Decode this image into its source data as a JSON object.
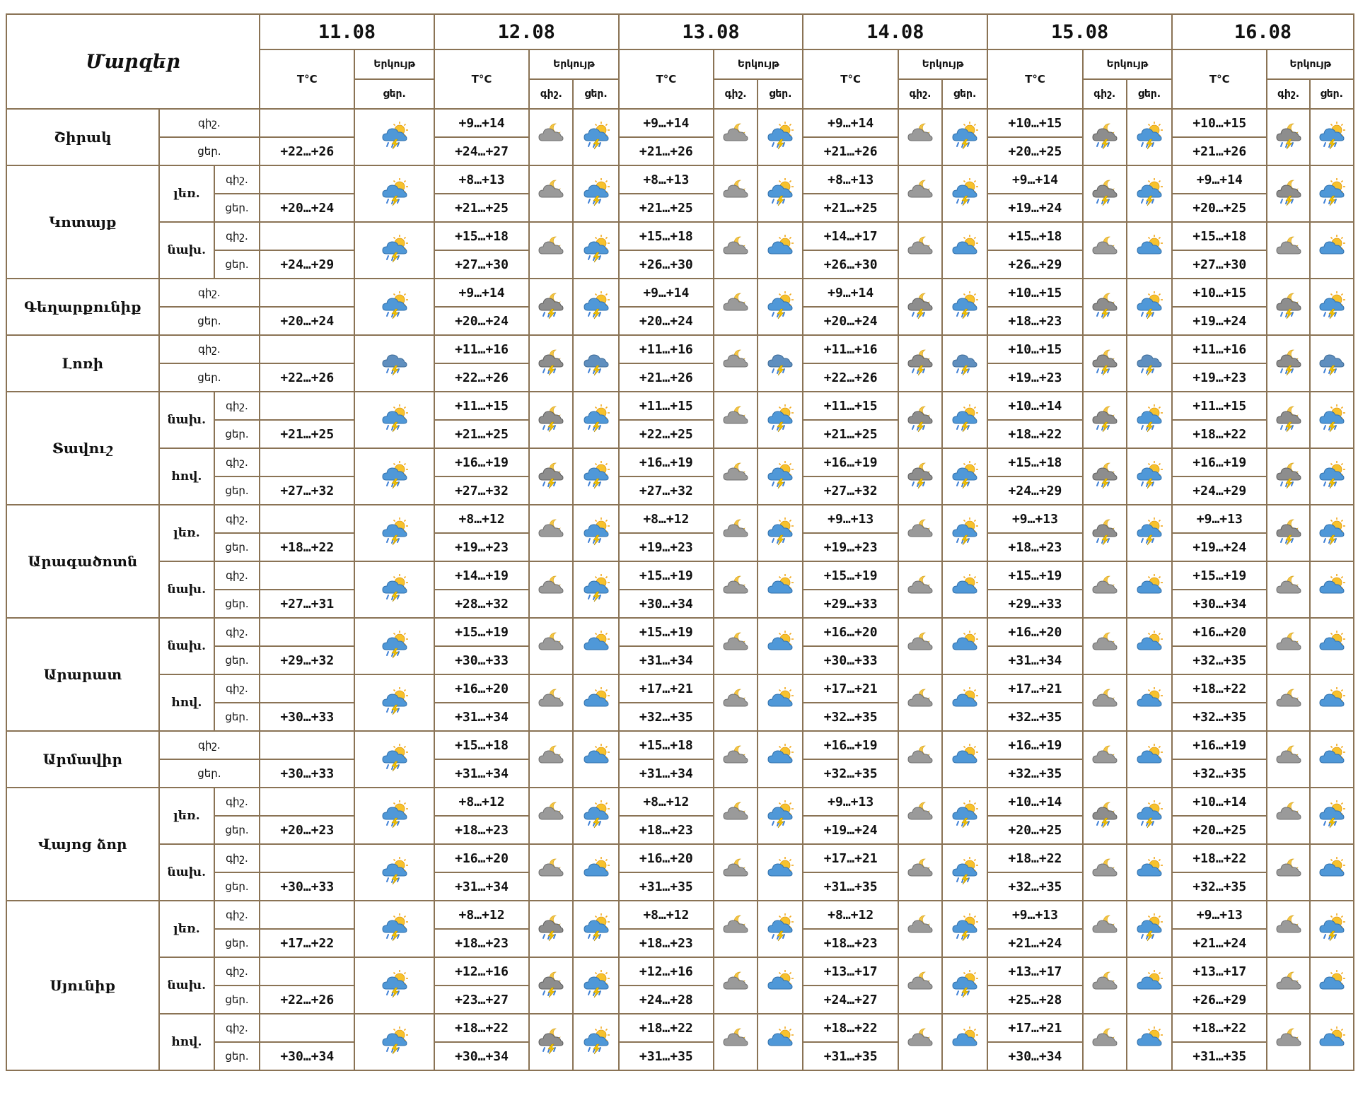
{
  "header": {
    "regions_label": "Մարզեր",
    "temp_label": "T°C",
    "sky_label": "Երկույթ",
    "night_label": "գիշ.",
    "day_label": "ցեր.",
    "dates": [
      "11.08",
      "12.08",
      "13.08",
      "14.08",
      "15.08",
      "16.08"
    ]
  },
  "icon_legend": {
    "storm-cloud": "dark cloud with rain and lightning",
    "cloud-moon": "grey cloud with moon",
    "cloud-sun-storm": "sun behind cloud with rain and lightning",
    "cloud-sun": "sun behind blue cloud",
    "storm-moon": "grey cloud with moon, rain and lightning"
  },
  "regions": [
    {
      "name": "Շիրակ",
      "zones": [
        {
          "zone": "",
          "night": [
            "",
            "+9…+14",
            "+9…+14",
            "+9…+14",
            "+10…+15",
            "+10…+15"
          ],
          "day": [
            "+22…+26",
            "+24…+27",
            "+21…+26",
            "+21…+26",
            "+20…+25",
            "+21…+26"
          ],
          "icons_night": [
            "cloud-moon",
            "cloud-moon",
            "cloud-moon",
            "storm-moon",
            "storm-moon"
          ],
          "icons_day": [
            "cloud-sun-storm",
            "cloud-sun-storm",
            "cloud-sun-storm",
            "cloud-sun-storm",
            "cloud-sun-storm",
            "cloud-sun-storm"
          ]
        }
      ]
    },
    {
      "name": "Կոտայք",
      "zones": [
        {
          "zone": "լեռ.",
          "night": [
            "",
            "+8…+13",
            "+8…+13",
            "+8…+13",
            "+9…+14",
            "+9…+14"
          ],
          "day": [
            "+20…+24",
            "+21…+25",
            "+21…+25",
            "+21…+25",
            "+19…+24",
            "+20…+25"
          ],
          "icons_night": [
            "cloud-moon",
            "cloud-moon",
            "cloud-moon",
            "storm-moon",
            "storm-moon"
          ],
          "icons_day": [
            "cloud-sun-storm",
            "cloud-sun-storm",
            "cloud-sun-storm",
            "cloud-sun-storm",
            "cloud-sun-storm",
            "cloud-sun-storm"
          ]
        },
        {
          "zone": "նախ.",
          "night": [
            "",
            "+15…+18",
            "+15…+18",
            "+14…+17",
            "+15…+18",
            "+15…+18"
          ],
          "day": [
            "+24…+29",
            "+27…+30",
            "+26…+30",
            "+26…+30",
            "+26…+29",
            "+27…+30"
          ],
          "icons_night": [
            "cloud-moon",
            "cloud-moon",
            "cloud-moon",
            "cloud-moon",
            "cloud-moon"
          ],
          "icons_day": [
            "cloud-sun-storm",
            "cloud-sun-storm",
            "cloud-sun",
            "cloud-sun",
            "cloud-sun",
            "cloud-sun"
          ]
        }
      ]
    },
    {
      "name": "Գեղարքունիք",
      "zones": [
        {
          "zone": "",
          "night": [
            "",
            "+9…+14",
            "+9…+14",
            "+9…+14",
            "+10…+15",
            "+10…+15"
          ],
          "day": [
            "+20…+24",
            "+20…+24",
            "+20…+24",
            "+20…+24",
            "+18…+23",
            "+19…+24"
          ],
          "icons_night": [
            "storm-moon",
            "cloud-moon",
            "storm-moon",
            "storm-moon",
            "storm-moon"
          ],
          "icons_day": [
            "cloud-sun-storm",
            "cloud-sun-storm",
            "cloud-sun-storm",
            "cloud-sun-storm",
            "cloud-sun-storm",
            "cloud-sun-storm"
          ]
        }
      ]
    },
    {
      "name": "Լոռի",
      "zones": [
        {
          "zone": "",
          "night": [
            "",
            "+11…+16",
            "+11…+16",
            "+11…+16",
            "+10…+15",
            "+11…+16"
          ],
          "day": [
            "+22…+26",
            "+22…+26",
            "+21…+26",
            "+22…+26",
            "+19…+23",
            "+19…+23"
          ],
          "icons_night": [
            "storm-moon",
            "cloud-moon",
            "storm-moon",
            "storm-moon",
            "storm-moon"
          ],
          "icons_day": [
            "storm-cloud",
            "storm-cloud",
            "storm-cloud",
            "storm-cloud",
            "storm-cloud",
            "storm-cloud"
          ]
        }
      ]
    },
    {
      "name": "Տավուշ",
      "zones": [
        {
          "zone": "նախ.",
          "night": [
            "",
            "+11…+15",
            "+11…+15",
            "+11…+15",
            "+10…+14",
            "+11…+15"
          ],
          "day": [
            "+21…+25",
            "+21…+25",
            "+22…+25",
            "+21…+25",
            "+18…+22",
            "+18…+22"
          ],
          "icons_night": [
            "storm-moon",
            "cloud-moon",
            "storm-moon",
            "storm-moon",
            "storm-moon"
          ],
          "icons_day": [
            "cloud-sun-storm",
            "cloud-sun-storm",
            "cloud-sun-storm",
            "cloud-sun-storm",
            "cloud-sun-storm",
            "cloud-sun-storm"
          ]
        },
        {
          "zone": "հով.",
          "night": [
            "",
            "+16…+19",
            "+16…+19",
            "+16…+19",
            "+15…+18",
            "+16…+19"
          ],
          "day": [
            "+27…+32",
            "+27…+32",
            "+27…+32",
            "+27…+32",
            "+24…+29",
            "+24…+29"
          ],
          "icons_night": [
            "storm-moon",
            "cloud-moon",
            "storm-moon",
            "storm-moon",
            "storm-moon"
          ],
          "icons_day": [
            "cloud-sun-storm",
            "cloud-sun-storm",
            "cloud-sun-storm",
            "cloud-sun-storm",
            "cloud-sun-storm",
            "cloud-sun-storm"
          ]
        }
      ]
    },
    {
      "name": "Արագածոտն",
      "zones": [
        {
          "zone": "լեռ.",
          "night": [
            "",
            "+8…+12",
            "+8…+12",
            "+9…+13",
            "+9…+13",
            "+9…+13"
          ],
          "day": [
            "+18…+22",
            "+19…+23",
            "+19…+23",
            "+19…+23",
            "+18…+23",
            "+19…+24"
          ],
          "icons_night": [
            "cloud-moon",
            "cloud-moon",
            "cloud-moon",
            "storm-moon",
            "storm-moon"
          ],
          "icons_day": [
            "cloud-sun-storm",
            "cloud-sun-storm",
            "cloud-sun-storm",
            "cloud-sun-storm",
            "cloud-sun-storm",
            "cloud-sun-storm"
          ]
        },
        {
          "zone": "նախ.",
          "night": [
            "",
            "+14…+19",
            "+15…+19",
            "+15…+19",
            "+15…+19",
            "+15…+19"
          ],
          "day": [
            "+27…+31",
            "+28…+32",
            "+30…+34",
            "+29…+33",
            "+29…+33",
            "+30…+34"
          ],
          "icons_night": [
            "cloud-moon",
            "cloud-moon",
            "cloud-moon",
            "cloud-moon",
            "cloud-moon"
          ],
          "icons_day": [
            "cloud-sun-storm",
            "cloud-sun-storm",
            "cloud-sun",
            "cloud-sun",
            "cloud-sun",
            "cloud-sun"
          ]
        }
      ]
    },
    {
      "name": "Արարատ",
      "zones": [
        {
          "zone": "նախ.",
          "night": [
            "",
            "+15…+19",
            "+15…+19",
            "+16…+20",
            "+16…+20",
            "+16…+20"
          ],
          "day": [
            "+29…+32",
            "+30…+33",
            "+31…+34",
            "+30…+33",
            "+31…+34",
            "+32…+35"
          ],
          "icons_night": [
            "cloud-moon",
            "cloud-moon",
            "cloud-moon",
            "cloud-moon",
            "cloud-moon"
          ],
          "icons_day": [
            "cloud-sun-storm",
            "cloud-sun",
            "cloud-sun",
            "cloud-sun",
            "cloud-sun",
            "cloud-sun"
          ]
        },
        {
          "zone": "հով.",
          "night": [
            "",
            "+16…+20",
            "+17…+21",
            "+17…+21",
            "+17…+21",
            "+18…+22"
          ],
          "day": [
            "+30…+33",
            "+31…+34",
            "+32…+35",
            "+32…+35",
            "+32…+35",
            "+32…+35"
          ],
          "icons_night": [
            "cloud-moon",
            "cloud-moon",
            "cloud-moon",
            "cloud-moon",
            "cloud-moon"
          ],
          "icons_day": [
            "cloud-sun-storm",
            "cloud-sun",
            "cloud-sun",
            "cloud-sun",
            "cloud-sun",
            "cloud-sun"
          ]
        }
      ]
    },
    {
      "name": "Արմավիր",
      "zones": [
        {
          "zone": "",
          "night": [
            "",
            "+15…+18",
            "+15…+18",
            "+16…+19",
            "+16…+19",
            "+16…+19"
          ],
          "day": [
            "+30…+33",
            "+31…+34",
            "+31…+34",
            "+32…+35",
            "+32…+35",
            "+32…+35"
          ],
          "icons_night": [
            "cloud-moon",
            "cloud-moon",
            "cloud-moon",
            "cloud-moon",
            "cloud-moon"
          ],
          "icons_day": [
            "cloud-sun-storm",
            "cloud-sun",
            "cloud-sun",
            "cloud-sun",
            "cloud-sun",
            "cloud-sun"
          ]
        }
      ]
    },
    {
      "name": "Վայոց ձոր",
      "zones": [
        {
          "zone": "լեռ.",
          "night": [
            "",
            "+8…+12",
            "+8…+12",
            "+9…+13",
            "+10…+14",
            "+10…+14"
          ],
          "day": [
            "+20…+23",
            "+18…+23",
            "+18…+23",
            "+19…+24",
            "+20…+25",
            "+20…+25"
          ],
          "icons_night": [
            "cloud-moon",
            "cloud-moon",
            "cloud-moon",
            "storm-moon",
            "cloud-moon"
          ],
          "icons_day": [
            "cloud-sun-storm",
            "cloud-sun-storm",
            "cloud-sun-storm",
            "cloud-sun-storm",
            "cloud-sun-storm",
            "cloud-sun-storm"
          ]
        },
        {
          "zone": "նախ.",
          "night": [
            "",
            "+16…+20",
            "+16…+20",
            "+17…+21",
            "+18…+22",
            "+18…+22"
          ],
          "day": [
            "+30…+33",
            "+31…+34",
            "+31…+35",
            "+31…+35",
            "+32…+35",
            "+32…+35"
          ],
          "icons_night": [
            "cloud-moon",
            "cloud-moon",
            "cloud-moon",
            "cloud-moon",
            "cloud-moon"
          ],
          "icons_day": [
            "cloud-sun-storm",
            "cloud-sun",
            "cloud-sun",
            "cloud-sun-storm",
            "cloud-sun",
            "cloud-sun"
          ]
        }
      ]
    },
    {
      "name": "Սյունիք",
      "zones": [
        {
          "zone": "լեռ.",
          "night": [
            "",
            "+8…+12",
            "+8…+12",
            "+8…+12",
            "+9…+13",
            "+9…+13"
          ],
          "day": [
            "+17…+22",
            "+18…+23",
            "+18…+23",
            "+18…+23",
            "+21…+24",
            "+21…+24"
          ],
          "icons_night": [
            "storm-moon",
            "cloud-moon",
            "cloud-moon",
            "cloud-moon",
            "cloud-moon"
          ],
          "icons_day": [
            "cloud-sun-storm",
            "cloud-sun-storm",
            "cloud-sun-storm",
            "cloud-sun-storm",
            "cloud-sun-storm",
            "cloud-sun-storm"
          ]
        },
        {
          "zone": "նախ.",
          "night": [
            "",
            "+12…+16",
            "+12…+16",
            "+13…+17",
            "+13…+17",
            "+13…+17"
          ],
          "day": [
            "+22…+26",
            "+23…+27",
            "+24…+28",
            "+24…+27",
            "+25…+28",
            "+26…+29"
          ],
          "icons_night": [
            "storm-moon",
            "cloud-moon",
            "cloud-moon",
            "cloud-moon",
            "cloud-moon"
          ],
          "icons_day": [
            "cloud-sun-storm",
            "cloud-sun-storm",
            "cloud-sun",
            "cloud-sun-storm",
            "cloud-sun",
            "cloud-sun"
          ]
        },
        {
          "zone": "հով.",
          "night": [
            "",
            "+18…+22",
            "+18…+22",
            "+18…+22",
            "+17…+21",
            "+18…+22"
          ],
          "day": [
            "+30…+34",
            "+30…+34",
            "+31…+35",
            "+31…+35",
            "+30…+34",
            "+31…+35"
          ],
          "icons_night": [
            "storm-moon",
            "cloud-moon",
            "cloud-moon",
            "cloud-moon",
            "cloud-moon"
          ],
          "icons_day": [
            "cloud-sun-storm",
            "cloud-sun-storm",
            "cloud-sun",
            "cloud-sun",
            "cloud-sun",
            "cloud-sun"
          ]
        }
      ]
    }
  ]
}
